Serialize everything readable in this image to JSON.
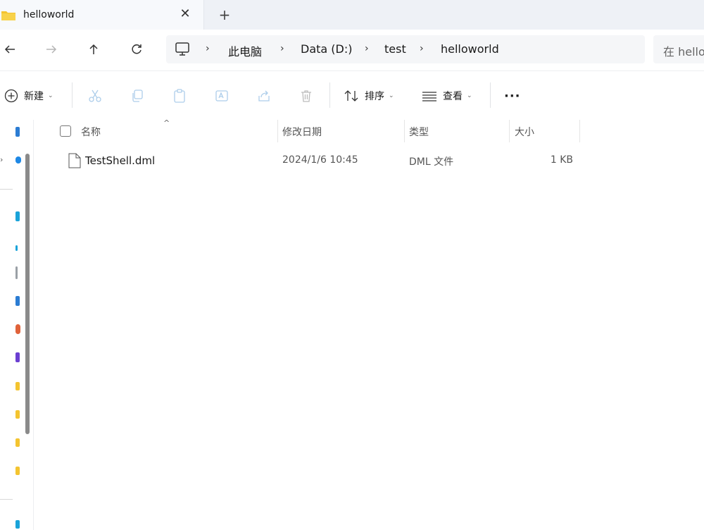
{
  "tab": {
    "title": "helloworld",
    "close": "✕",
    "new_tab": "+"
  },
  "address": {
    "crumbs": [
      "此电脑",
      "Data (D:)",
      "test",
      "helloworld"
    ],
    "separator": "›"
  },
  "search": {
    "placeholder": "在 hello"
  },
  "toolbar": {
    "new_label": "新建",
    "sort_label": "排序",
    "view_label": "查看",
    "more_label": "···"
  },
  "columns": {
    "name": "名称",
    "date": "修改日期",
    "type": "类型",
    "size": "大小"
  },
  "files": [
    {
      "name": "TestShell.dml",
      "date": "2024/1/6 10:45",
      "type": "DML 文件",
      "size": "1 KB"
    }
  ],
  "colors": {
    "accent": "#0067c0",
    "folder": "#f4c430"
  }
}
